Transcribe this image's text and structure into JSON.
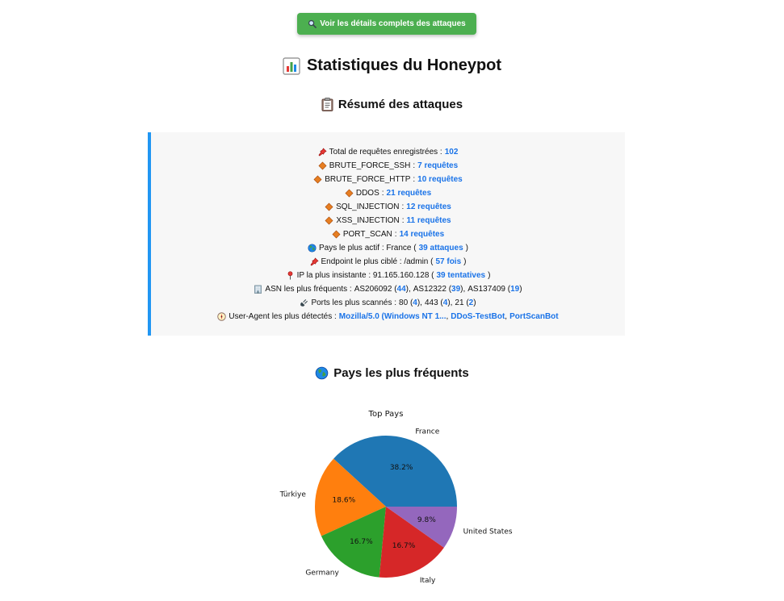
{
  "details_button": {
    "label": "Voir les détails complets des attaques"
  },
  "page_title": "Statistiques du Honeypot",
  "summary": {
    "title": "Résumé des attaques",
    "total_label": "Total de requêtes enregistrées :",
    "total_value": "102",
    "attack_types": [
      {
        "name": "BRUTE_FORCE_SSH",
        "count": "7 requêtes"
      },
      {
        "name": "BRUTE_FORCE_HTTP",
        "count": "10 requêtes"
      },
      {
        "name": "DDOS",
        "count": "21 requêtes"
      },
      {
        "name": "SQL_INJECTION",
        "count": "12 requêtes"
      },
      {
        "name": "XSS_INJECTION",
        "count": "11 requêtes"
      },
      {
        "name": "PORT_SCAN",
        "count": "14 requêtes"
      }
    ],
    "country_label": "Pays le plus actif : France (",
    "country_value": "39 attaques",
    "endpoint_label": "Endpoint le plus ciblé : /admin (",
    "endpoint_value": "57 fois",
    "ip_label": "IP la plus insistante : 91.165.160.128 (",
    "ip_value": "39 tentatives",
    "asn_label": "ASN les plus fréquents :",
    "asn": [
      {
        "name": "AS206092",
        "count": "44"
      },
      {
        "name": "AS12322",
        "count": "39"
      },
      {
        "name": "AS137409",
        "count": "19"
      }
    ],
    "ports_label": "Ports les plus scannés :",
    "ports": [
      {
        "port": "80",
        "count": "4"
      },
      {
        "port": "443",
        "count": "4"
      },
      {
        "port": "21",
        "count": "2"
      }
    ],
    "ua_label": "User-Agent les plus détectés :",
    "user_agents": [
      "Mozilla/5.0 (Windows NT 1...",
      "DDoS-TestBot",
      "PortScanBot"
    ]
  },
  "countries_title": "Pays les plus fréquents",
  "colors": {
    "button": "#4caf50",
    "accent": "#2196f3",
    "value": "#1a73e8"
  },
  "chart_data": {
    "type": "pie",
    "title": "Top Pays",
    "categories": [
      "France",
      "Türkiye",
      "Germany",
      "Italy",
      "United States"
    ],
    "values": [
      38.2,
      18.6,
      16.7,
      16.7,
      9.8
    ],
    "labels": [
      "38.2%",
      "18.6%",
      "16.7%",
      "16.7%",
      "9.8%"
    ],
    "colors": [
      "#1f77b4",
      "#ff7f0e",
      "#2ca02c",
      "#d62728",
      "#9467bd"
    ],
    "start_angle_deg": 0,
    "direction": "counterclockwise"
  }
}
